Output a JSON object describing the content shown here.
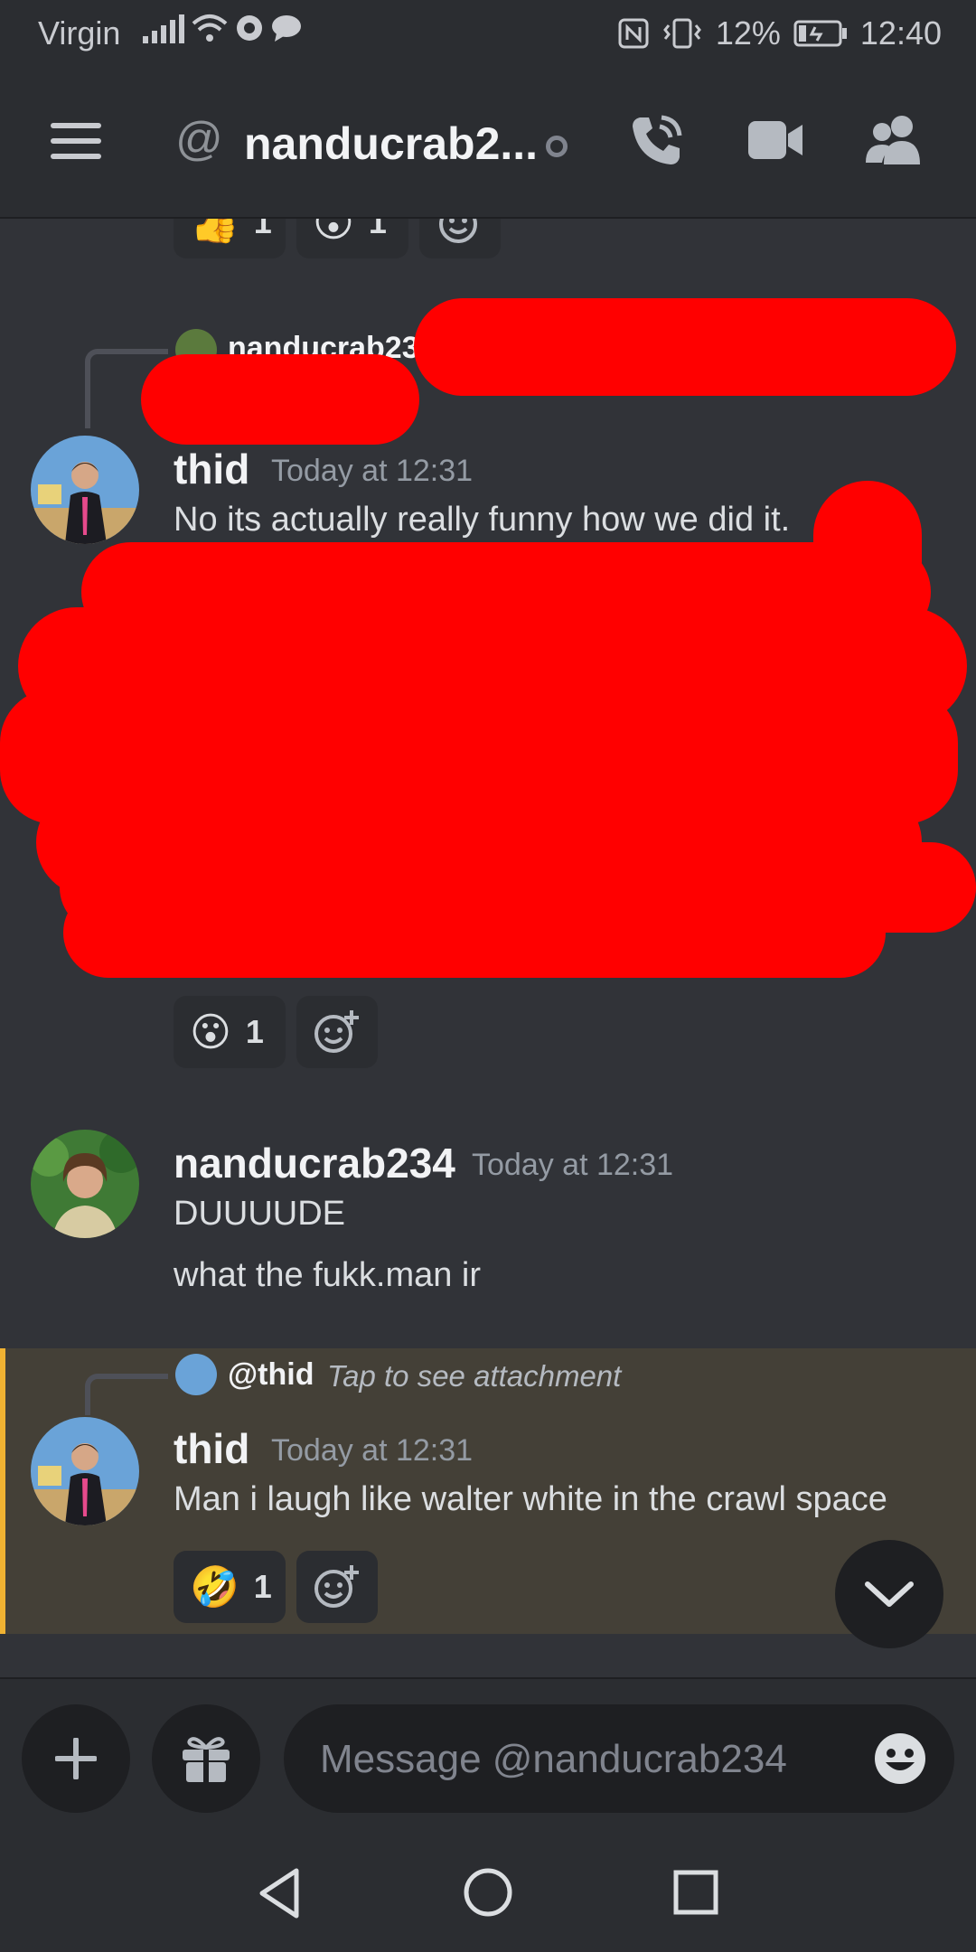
{
  "status_bar": {
    "carrier": "Virgin",
    "battery": "12%",
    "time": "12:40"
  },
  "header": {
    "at_symbol": "@",
    "title": "nanducrab2..."
  },
  "messages": [
    {
      "reactions": [
        {
          "emoji": "👍",
          "count": "1"
        },
        {
          "emoji": "😮",
          "count": "1"
        }
      ]
    },
    {
      "reply_to": "nanducrab234",
      "username": "thid",
      "timestamp": "Today at 12:31",
      "text": "No its actually really funny how we did it.",
      "reactions": [
        {
          "emoji": "😮",
          "count": "1"
        }
      ]
    },
    {
      "username": "nanducrab234",
      "timestamp": "Today at 12:31",
      "lines": [
        "DUUUUDE",
        "what the fukk.man ir"
      ]
    },
    {
      "reply_to": "@thid",
      "reply_text": "Tap to see attachment",
      "username": "thid",
      "timestamp": "Today at 12:31",
      "text": "Man i laugh like walter white in the crawl space",
      "reactions": [
        {
          "emoji": "🤣",
          "count": "1"
        }
      ]
    }
  ],
  "composer": {
    "placeholder": "Message @nanducrab234"
  },
  "colors": {
    "background": "#313338",
    "header": "#2b2d31",
    "highlight": "#444037",
    "mention_bar": "#f0b232",
    "redaction": "#ff0000"
  },
  "icons": [
    "menu-icon",
    "phone-call-icon",
    "video-call-icon",
    "members-icon",
    "add-reaction-icon",
    "plus-icon",
    "gift-icon",
    "emoji-icon",
    "chevron-down-icon",
    "back-icon",
    "home-icon",
    "recents-icon"
  ]
}
